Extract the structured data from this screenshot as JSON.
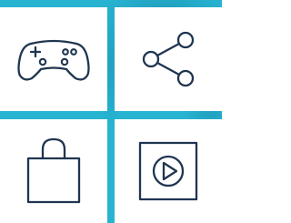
{
  "grid": {
    "tiles": [
      {
        "icon": "gamepad-icon",
        "meaning": "games"
      },
      {
        "icon": "share-icon",
        "meaning": "share"
      },
      {
        "icon": "shopping-bag-icon",
        "meaning": "shopping"
      },
      {
        "icon": "play-button-icon",
        "meaning": "media"
      }
    ]
  },
  "colors": {
    "background": "#27b4d1",
    "tile": "#ffffff",
    "icon_stroke": "#1f3550"
  }
}
